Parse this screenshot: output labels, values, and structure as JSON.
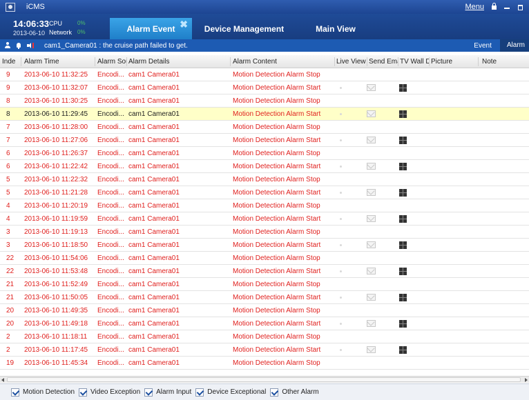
{
  "window": {
    "title": "iCMS",
    "menu_label": "Menu"
  },
  "header": {
    "time": "14:06:33",
    "date": "2013-06-10",
    "cpu_label": "CPU",
    "cpu_value": "0%",
    "network_label": "Network",
    "network_value": "0%",
    "tabs": [
      {
        "label": "Alarm Event",
        "active": true
      },
      {
        "label": "Device Management",
        "active": false
      },
      {
        "label": "Main View",
        "active": false
      }
    ]
  },
  "toolbar": {
    "message": "cam1_Camera01 : the cruise path failed to get.",
    "event_label": "Event",
    "alarm_label": "Alarm"
  },
  "table": {
    "headers": [
      "Inde",
      "Alarm Time",
      "Alarm Sou",
      "Alarm Details",
      "Alarm Content",
      "Live View",
      "Send Ema",
      "TV Wall Di",
      "Picture",
      "Note"
    ],
    "rows": [
      {
        "index": "9",
        "time": "2013-06-10 11:32:25",
        "source": "Encodi...",
        "details": "cam1 Camera01",
        "content": "Motion Detection Alarm Stop",
        "icons": false,
        "selected": false
      },
      {
        "index": "9",
        "time": "2013-06-10 11:32:07",
        "source": "Encodi...",
        "details": "cam1 Camera01",
        "content": "Motion Detection Alarm Start",
        "icons": true,
        "selected": false
      },
      {
        "index": "8",
        "time": "2013-06-10 11:30:25",
        "source": "Encodi...",
        "details": "cam1 Camera01",
        "content": "Motion Detection Alarm Stop",
        "icons": false,
        "selected": false
      },
      {
        "index": "8",
        "time": "2013-06-10 11:29:45",
        "source": "Encodi...",
        "details": "cam1 Camera01",
        "content": "Motion Detection Alarm Start",
        "icons": true,
        "selected": true
      },
      {
        "index": "7",
        "time": "2013-06-10 11:28:00",
        "source": "Encodi...",
        "details": "cam1 Camera01",
        "content": "Motion Detection Alarm Stop",
        "icons": false,
        "selected": false
      },
      {
        "index": "7",
        "time": "2013-06-10 11:27:06",
        "source": "Encodi...",
        "details": "cam1 Camera01",
        "content": "Motion Detection Alarm Start",
        "icons": true,
        "selected": false
      },
      {
        "index": "6",
        "time": "2013-06-10 11:26:37",
        "source": "Encodi...",
        "details": "cam1 Camera01",
        "content": "Motion Detection Alarm Stop",
        "icons": false,
        "selected": false
      },
      {
        "index": "6",
        "time": "2013-06-10 11:22:42",
        "source": "Encodi...",
        "details": "cam1 Camera01",
        "content": "Motion Detection Alarm Start",
        "icons": true,
        "selected": false
      },
      {
        "index": "5",
        "time": "2013-06-10 11:22:32",
        "source": "Encodi...",
        "details": "cam1 Camera01",
        "content": "Motion Detection Alarm Stop",
        "icons": false,
        "selected": false
      },
      {
        "index": "5",
        "time": "2013-06-10 11:21:28",
        "source": "Encodi...",
        "details": "cam1 Camera01",
        "content": "Motion Detection Alarm Start",
        "icons": true,
        "selected": false
      },
      {
        "index": "4",
        "time": "2013-06-10 11:20:19",
        "source": "Encodi...",
        "details": "cam1 Camera01",
        "content": "Motion Detection Alarm Stop",
        "icons": false,
        "selected": false
      },
      {
        "index": "4",
        "time": "2013-06-10 11:19:59",
        "source": "Encodi...",
        "details": "cam1 Camera01",
        "content": "Motion Detection Alarm Start",
        "icons": true,
        "selected": false
      },
      {
        "index": "3",
        "time": "2013-06-10 11:19:13",
        "source": "Encodi...",
        "details": "cam1 Camera01",
        "content": "Motion Detection Alarm Stop",
        "icons": false,
        "selected": false
      },
      {
        "index": "3",
        "time": "2013-06-10 11:18:50",
        "source": "Encodi...",
        "details": "cam1 Camera01",
        "content": "Motion Detection Alarm Start",
        "icons": true,
        "selected": false
      },
      {
        "index": "22",
        "time": "2013-06-10 11:54:06",
        "source": "Encodi...",
        "details": "cam1 Camera01",
        "content": "Motion Detection Alarm Stop",
        "icons": false,
        "selected": false
      },
      {
        "index": "22",
        "time": "2013-06-10 11:53:48",
        "source": "Encodi...",
        "details": "cam1 Camera01",
        "content": "Motion Detection Alarm Start",
        "icons": true,
        "selected": false
      },
      {
        "index": "21",
        "time": "2013-06-10 11:52:49",
        "source": "Encodi...",
        "details": "cam1 Camera01",
        "content": "Motion Detection Alarm Stop",
        "icons": false,
        "selected": false
      },
      {
        "index": "21",
        "time": "2013-06-10 11:50:05",
        "source": "Encodi...",
        "details": "cam1 Camera01",
        "content": "Motion Detection Alarm Start",
        "icons": true,
        "selected": false
      },
      {
        "index": "20",
        "time": "2013-06-10 11:49:35",
        "source": "Encodi...",
        "details": "cam1 Camera01",
        "content": "Motion Detection Alarm Stop",
        "icons": false,
        "selected": false
      },
      {
        "index": "20",
        "time": "2013-06-10 11:49:18",
        "source": "Encodi...",
        "details": "cam1 Camera01",
        "content": "Motion Detection Alarm Start",
        "icons": true,
        "selected": false
      },
      {
        "index": "2",
        "time": "2013-06-10 11:18:11",
        "source": "Encodi...",
        "details": "cam1 Camera01",
        "content": "Motion Detection Alarm Stop",
        "icons": false,
        "selected": false
      },
      {
        "index": "2",
        "time": "2013-06-10 11:17:45",
        "source": "Encodi...",
        "details": "cam1 Camera01",
        "content": "Motion Detection Alarm Start",
        "icons": true,
        "selected": false
      },
      {
        "index": "19",
        "time": "2013-06-10 11:45:34",
        "source": "Encodi...",
        "details": "cam1 Camera01",
        "content": "Motion Detection Alarm Stop",
        "icons": false,
        "selected": false
      }
    ]
  },
  "filters": [
    {
      "label": "Motion Detection",
      "checked": true
    },
    {
      "label": "Video Exception",
      "checked": true
    },
    {
      "label": "Alarm Input",
      "checked": true
    },
    {
      "label": "Device Exceptional",
      "checked": true
    },
    {
      "label": "Other Alarm",
      "checked": true
    }
  ],
  "colors": {
    "alarm_text": "#e0201e",
    "selected_row": "#ffffc8",
    "active_tab": "#2a93dd"
  }
}
